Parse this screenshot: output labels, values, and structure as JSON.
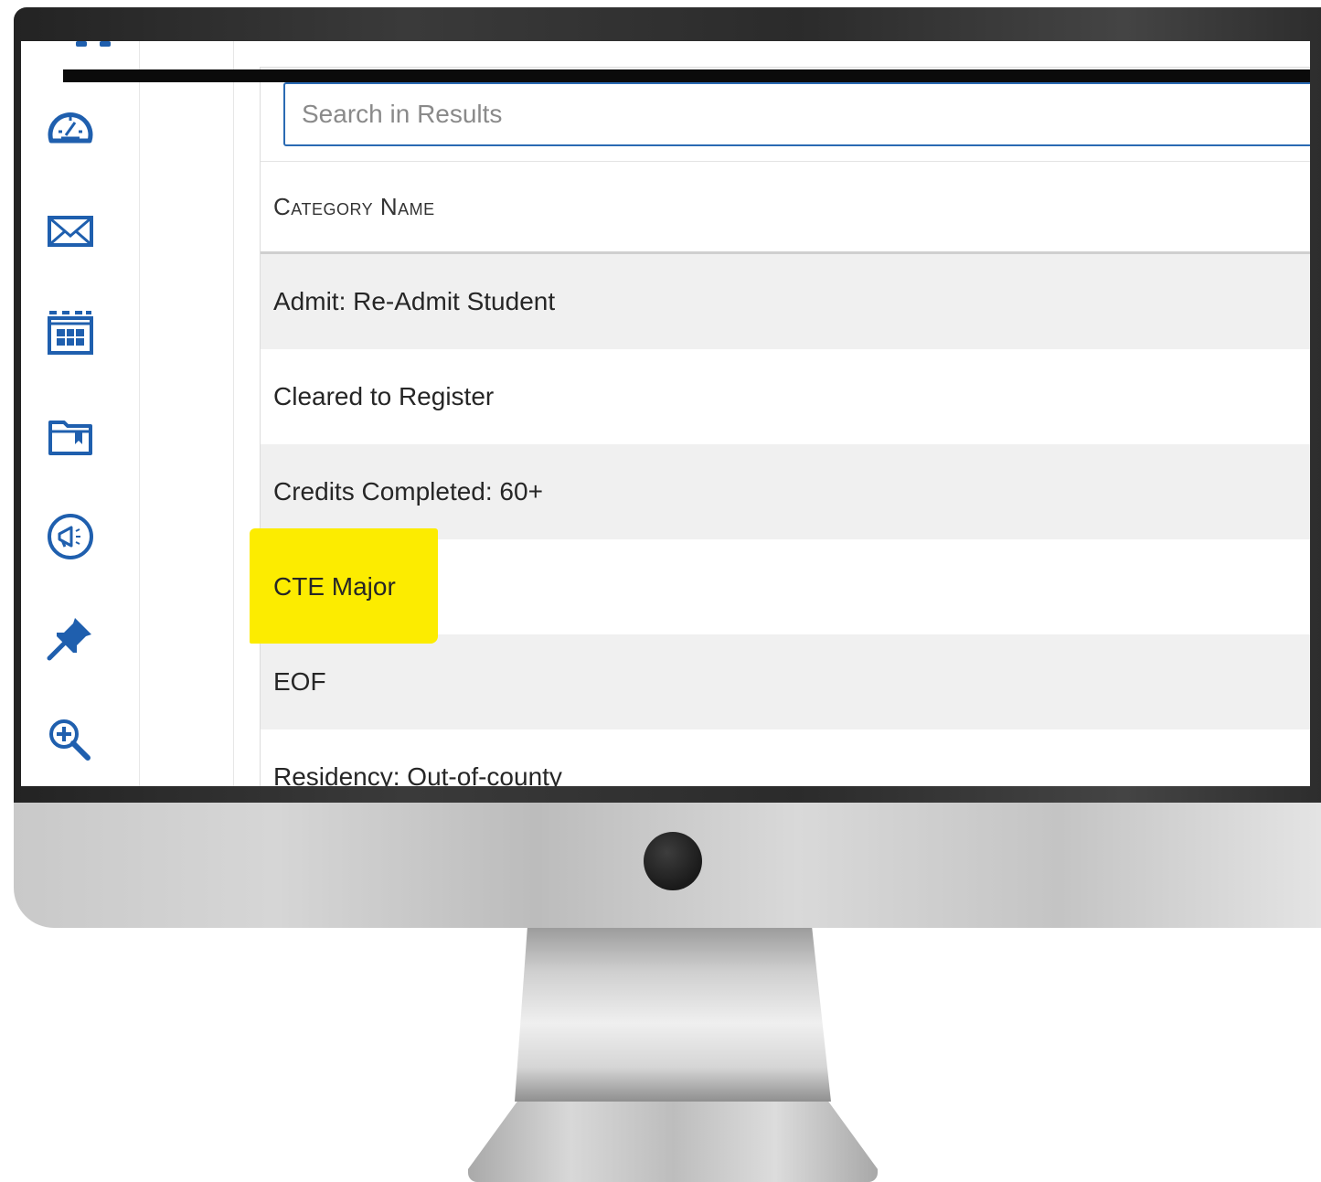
{
  "search": {
    "placeholder": "Search in Results",
    "value": ""
  },
  "table": {
    "header": "Category Name",
    "rows": [
      {
        "label": "Admit: Re-Admit Student",
        "highlighted": false
      },
      {
        "label": "Cleared to Register",
        "highlighted": false
      },
      {
        "label": "Credits Completed: 60+",
        "highlighted": false
      },
      {
        "label": "CTE Major",
        "highlighted": true
      },
      {
        "label": "EOF",
        "highlighted": false
      },
      {
        "label": "Residency: Out-of-county",
        "highlighted": false
      }
    ]
  },
  "sidebar": {
    "icons": [
      "dashboard-icon",
      "mail-icon",
      "calendar-icon",
      "folder-icon",
      "megaphone-icon",
      "pin-icon",
      "zoom-in-icon"
    ]
  },
  "colors": {
    "accent": "#1f5fae",
    "highlight": "#fcec00",
    "row_stripe": "#f0f0f0"
  }
}
